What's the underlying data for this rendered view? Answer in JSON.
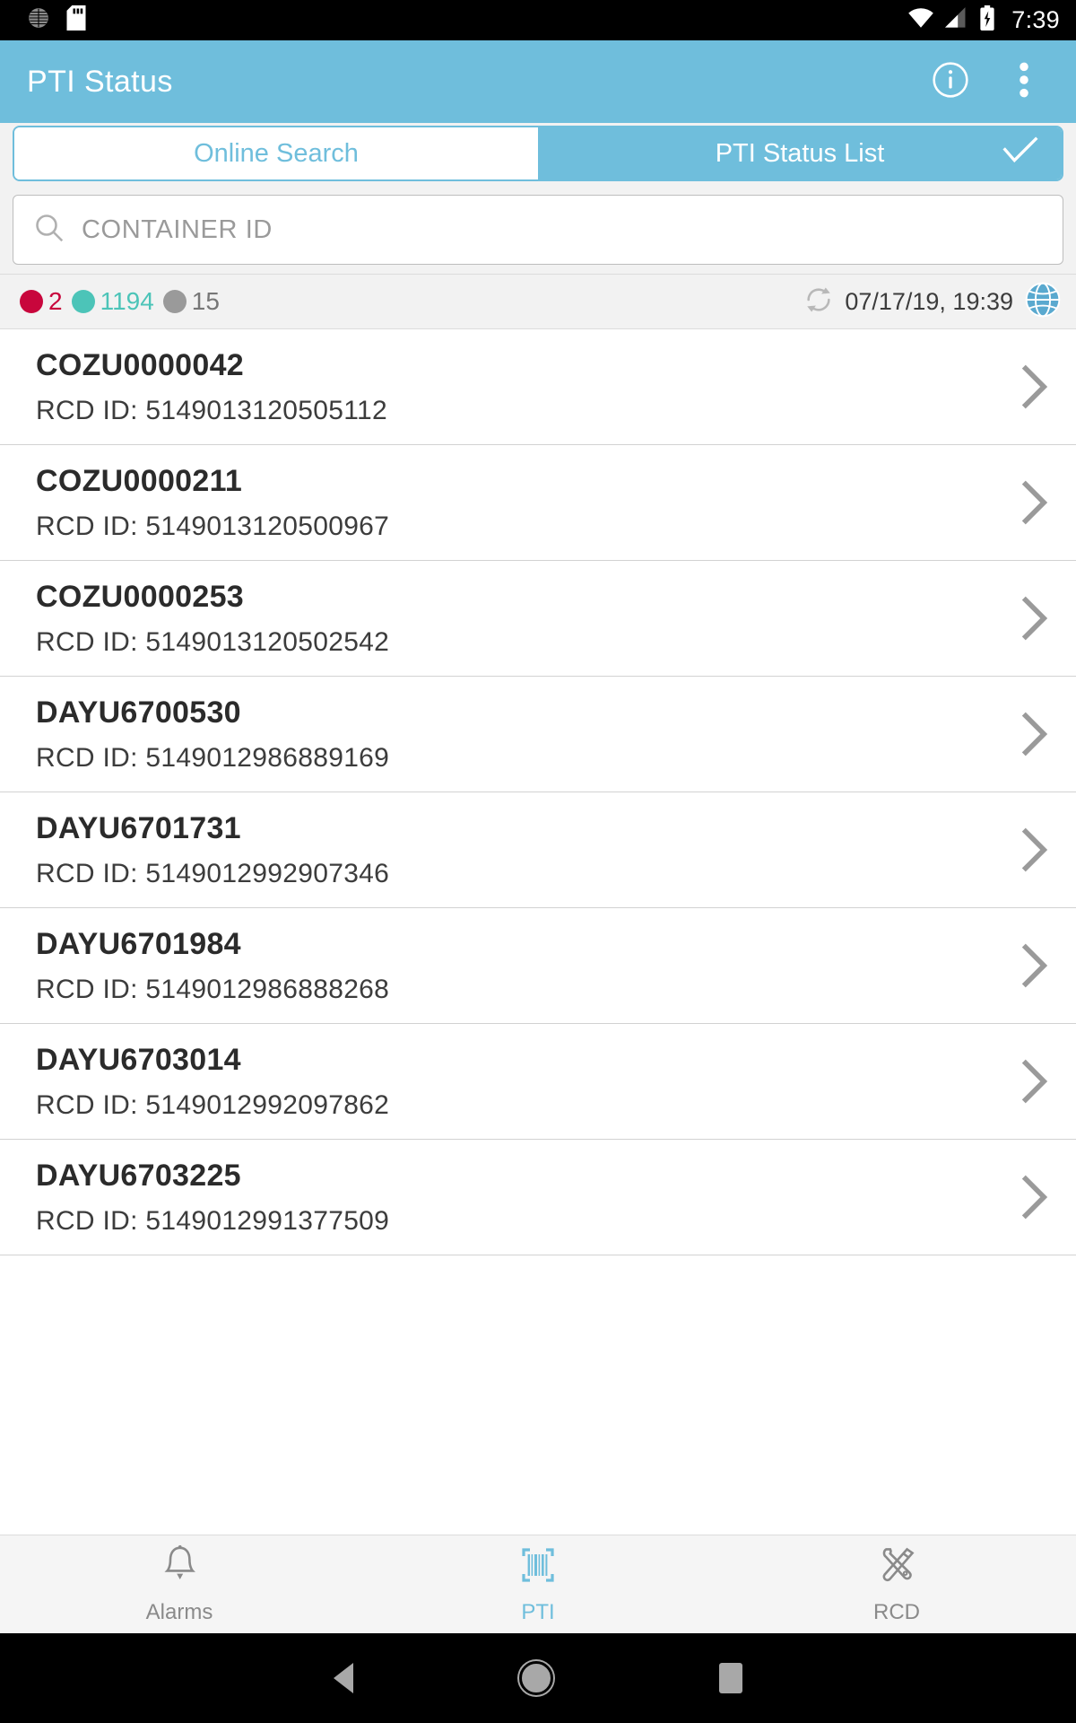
{
  "statusbar": {
    "time": "7:39",
    "icons_left": [
      "brightness-icon",
      "sd-card-icon"
    ],
    "icons_right": [
      "wifi-icon",
      "cellular-signal-icon",
      "battery-charging-icon"
    ]
  },
  "appbar": {
    "title": "PTI Status",
    "info_icon": "info-icon",
    "overflow_icon": "overflow-menu-icon",
    "background": "#6fbedc"
  },
  "tabs": [
    {
      "label": "Online Search",
      "active": false
    },
    {
      "label": "PTI Status List",
      "active": true,
      "check_icon": "check-icon"
    }
  ],
  "search": {
    "placeholder": "CONTAINER ID",
    "value": "",
    "icon": "search-icon"
  },
  "summary": {
    "counters": [
      {
        "color": "#c8063c",
        "value": "2",
        "text_color": "#c8063c"
      },
      {
        "color": "#4cc4b8",
        "value": "1194",
        "text_color": "#4cc4b8"
      },
      {
        "color": "#9a9a9a",
        "value": "15",
        "text_color": "#777777"
      }
    ],
    "refresh_icon": "refresh-icon",
    "timestamp": "07/17/19, 19:39",
    "globe_icon": "globe-icon"
  },
  "list": {
    "rcd_label": "RCD ID: ",
    "chevron_icon": "chevron-right-icon",
    "rows": [
      {
        "container_id": "COZU0000042",
        "rcd_id": "RCD ID: 5149013120505112"
      },
      {
        "container_id": "COZU0000211",
        "rcd_id": "RCD ID: 5149013120500967"
      },
      {
        "container_id": "COZU0000253",
        "rcd_id": "RCD ID: 5149013120502542"
      },
      {
        "container_id": "DAYU6700530",
        "rcd_id": "RCD ID: 5149012986889169"
      },
      {
        "container_id": "DAYU6701731",
        "rcd_id": "RCD ID: 5149012992907346"
      },
      {
        "container_id": "DAYU6701984",
        "rcd_id": "RCD ID: 5149012986888268"
      },
      {
        "container_id": "DAYU6703014",
        "rcd_id": "RCD ID: 5149012992097862"
      },
      {
        "container_id": "DAYU6703225",
        "rcd_id": "RCD ID: 5149012991377509"
      }
    ]
  },
  "bottomnav": {
    "items": [
      {
        "label": "Alarms",
        "icon": "bell-icon",
        "active": false
      },
      {
        "label": "PTI",
        "icon": "barcode-icon",
        "active": true
      },
      {
        "label": "RCD",
        "icon": "tools-icon",
        "active": false
      }
    ],
    "active_color": "#6fbedc"
  },
  "androidnav": {
    "back": "back-triangle-icon",
    "home": "home-circle-icon",
    "recents": "recents-square-icon"
  }
}
